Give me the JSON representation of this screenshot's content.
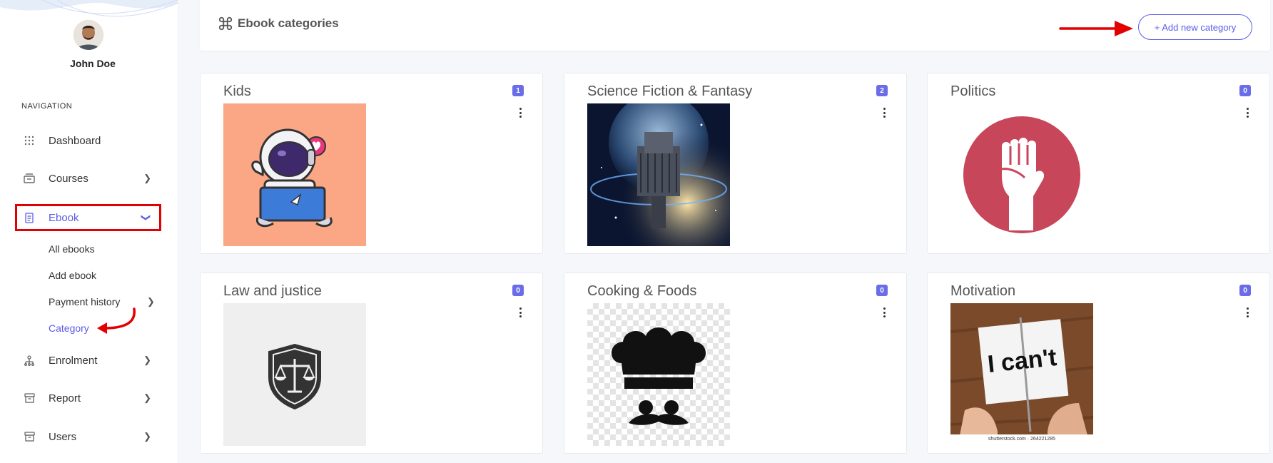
{
  "user": {
    "name": "John Doe"
  },
  "sidebar": {
    "heading": "NAVIGATION",
    "items": [
      {
        "label": "Dashboard",
        "icon": "grid-icon"
      },
      {
        "label": "Courses",
        "icon": "courses-icon"
      },
      {
        "label": "Ebook",
        "icon": "ebook-icon"
      },
      {
        "label": "Enrolment",
        "icon": "enrolment-icon"
      },
      {
        "label": "Report",
        "icon": "report-icon"
      },
      {
        "label": "Users",
        "icon": "users-icon"
      }
    ],
    "ebook_sub": [
      {
        "label": "All ebooks"
      },
      {
        "label": "Add ebook"
      },
      {
        "label": "Payment history"
      },
      {
        "label": "Category"
      }
    ]
  },
  "header": {
    "title": "Ebook categories",
    "add_button": "+ Add new category"
  },
  "categories": [
    {
      "name": "Kids",
      "count": "1"
    },
    {
      "name": "Science Fiction & Fantasy",
      "count": "2"
    },
    {
      "name": "Politics",
      "count": "0"
    },
    {
      "name": "Law and justice",
      "count": "0"
    },
    {
      "name": "Cooking & Foods",
      "count": "0"
    },
    {
      "name": "Motivation",
      "count": "0"
    }
  ],
  "thumbnails": {
    "motivation_text": "I can't",
    "motivation_caption": "shutterstock.com · 264221285"
  },
  "colors": {
    "accent": "#5b5de6",
    "badge": "#6b6de8",
    "annotation": "#e30000"
  }
}
